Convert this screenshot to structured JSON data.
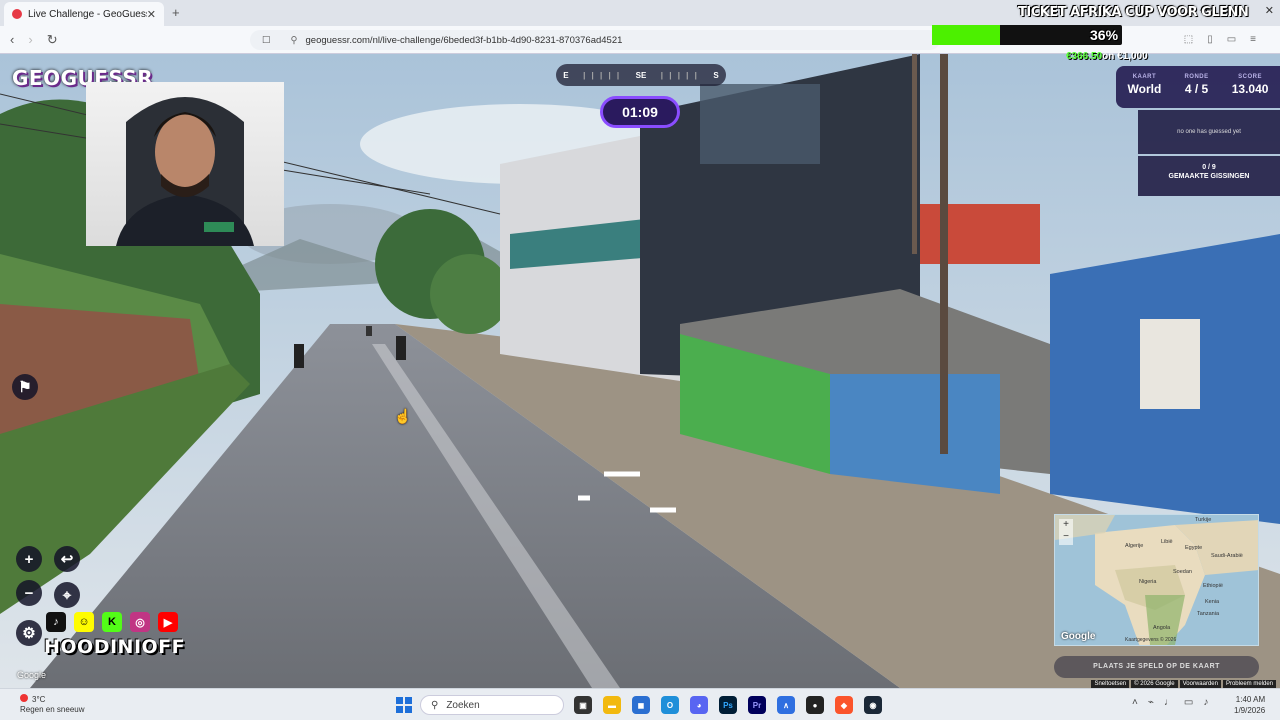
{
  "browser": {
    "tab_title": "Live Challenge - GeoGuessr",
    "url": "geoguessr.com/nl/live-challenge/6beded3f-b1bb-4d90-8231-870376ad4521"
  },
  "stream_overlay": {
    "title": "TICKET AFRIKA CUP VOOR GLENN",
    "progress_percent": 36,
    "progress_label": "36%",
    "raised": "€366.50",
    "goal_text": "on €1,000",
    "bar_color": "#4cf000"
  },
  "game": {
    "logo": "GEOGUESSR",
    "compass": [
      "E",
      "SE",
      "S"
    ],
    "timer": "01:09",
    "map_label": "KAART",
    "map_value": "World",
    "round_label": "RONDE",
    "round_value": "4 / 5",
    "score_label": "SCORE",
    "score_value": "13.040",
    "no_guess_text": "no one has guessed yet",
    "guesses_count": "0 / 9",
    "guesses_label": "GEMAAKTE GISSINGEN",
    "place_guess": "PLAATS JE SPELD OP DE KAART",
    "google_watermark": "Google",
    "streamer_handle": "HOODINIOFF"
  },
  "minimap": {
    "google": "Google",
    "attribution": "Kaartgegevens © 2026",
    "countries": [
      "Turkije",
      "Egypte",
      "Saudi-Arabië",
      "Algerije",
      "Libië",
      "Soedan",
      "Nigeria",
      "Ethiopië",
      "Kenia",
      "Tanzania",
      "Angola"
    ]
  },
  "footer_links": [
    "Sneltoetsen",
    "© 2026 Google",
    "Voorwaarden",
    "Probleem melden"
  ],
  "taskbar": {
    "weather_temp": "3°C",
    "weather_desc": "Regen en sneeuw",
    "search_placeholder": "Zoeken",
    "time": "1:40 AM",
    "date": "1/9/2026"
  }
}
